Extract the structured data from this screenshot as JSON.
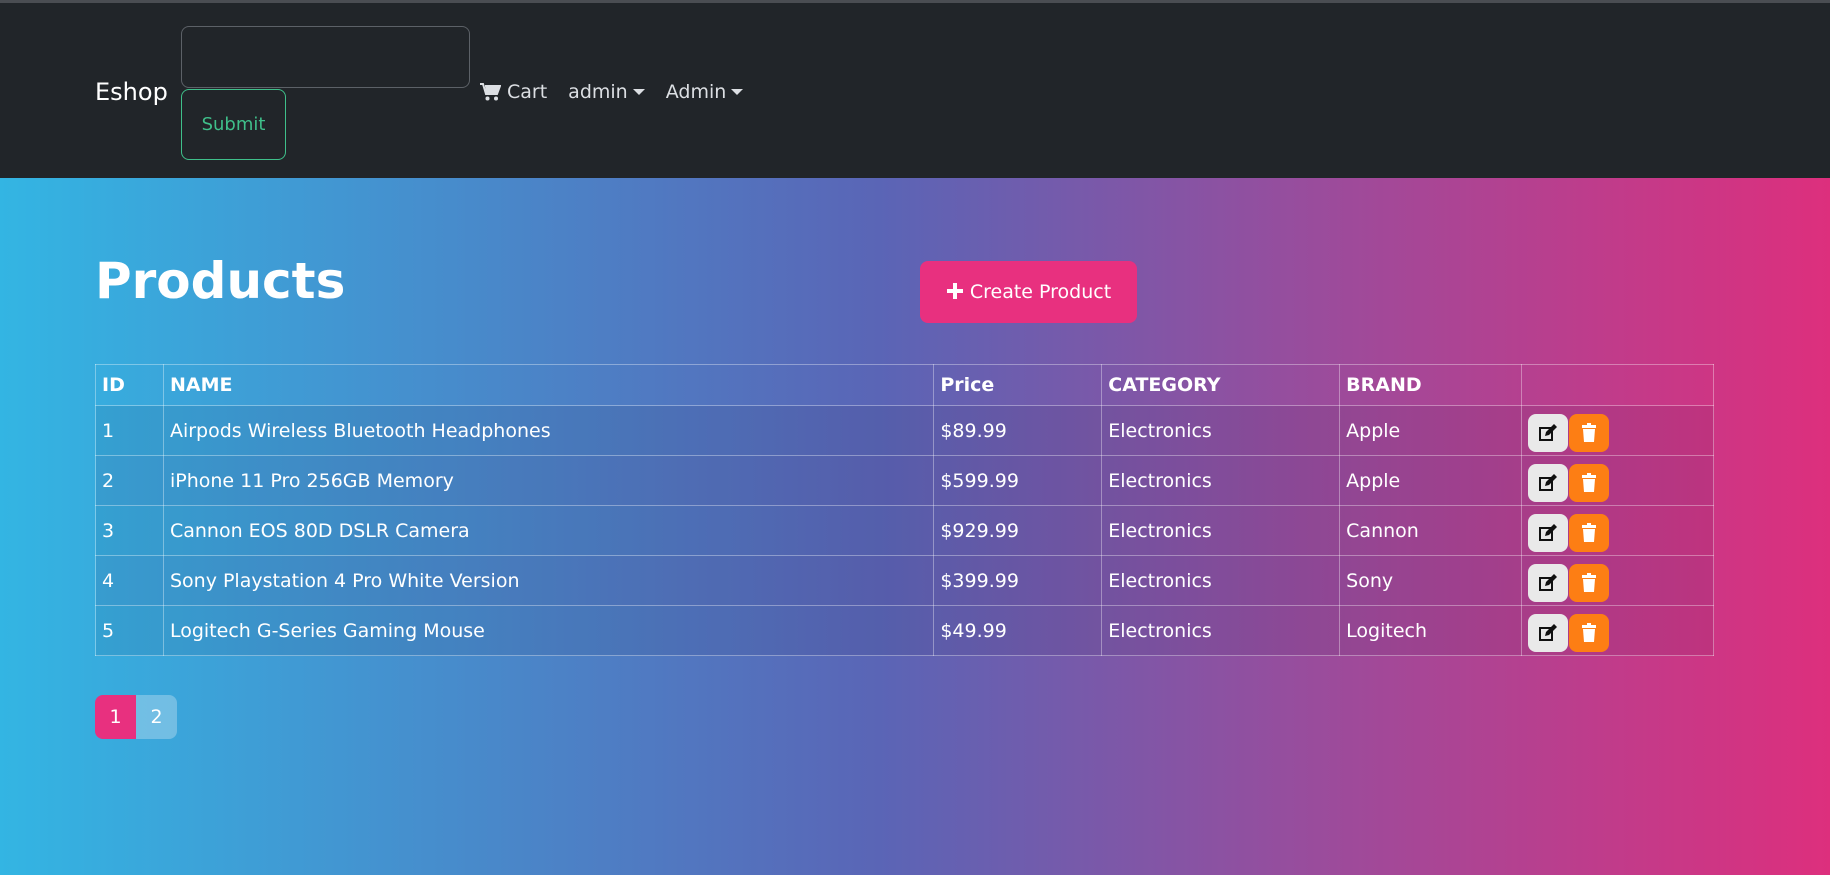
{
  "navbar": {
    "brand": "Eshop",
    "search_value": "",
    "submit_label": "Submit",
    "cart_label": "Cart",
    "user_menu_label": "admin",
    "admin_menu_label": "Admin"
  },
  "page": {
    "title": "Products",
    "create_button_label": "Create Product"
  },
  "table": {
    "headers": [
      "ID",
      "NAME",
      "Price",
      "CATEGORY",
      "BRAND",
      ""
    ],
    "rows": [
      {
        "id": "1",
        "name": "Airpods Wireless Bluetooth Headphones",
        "price": "$89.99",
        "category": "Electronics",
        "brand": "Apple"
      },
      {
        "id": "2",
        "name": "iPhone 11 Pro 256GB Memory",
        "price": "$599.99",
        "category": "Electronics",
        "brand": "Apple"
      },
      {
        "id": "3",
        "name": "Cannon EOS 80D DSLR Camera",
        "price": "$929.99",
        "category": "Electronics",
        "brand": "Cannon"
      },
      {
        "id": "4",
        "name": "Sony Playstation 4 Pro White Version",
        "price": "$399.99",
        "category": "Electronics",
        "brand": "Sony"
      },
      {
        "id": "5",
        "name": "Logitech G-Series Gaming Mouse",
        "price": "$49.99",
        "category": "Electronics",
        "brand": "Logitech"
      }
    ]
  },
  "pagination": {
    "pages": [
      "1",
      "2"
    ],
    "active": "1"
  },
  "icons": {
    "cart": "shopping-cart-icon",
    "plus": "plus-icon",
    "edit": "edit-icon",
    "delete": "trash-icon"
  },
  "colors": {
    "navbar_bg": "#212529",
    "accent_pink": "#e8307f",
    "submit_green": "#3fbf8a",
    "delete_orange": "#fd7e14",
    "gradient_start": "#33b5e3",
    "gradient_end": "#dd2f7d"
  }
}
